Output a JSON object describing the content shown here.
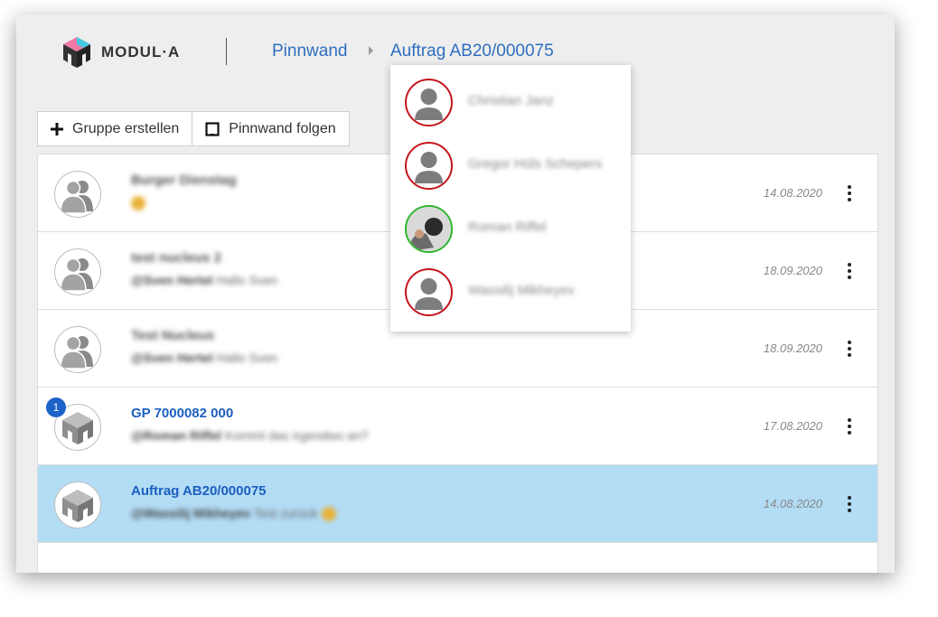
{
  "header": {
    "logo_text": "MODUL·A",
    "breadcrumb": [
      "Pinnwand",
      "Auftrag AB20/000075"
    ]
  },
  "toolbar": {
    "create_group_label": "Gruppe erstellen",
    "follow_label": "Pinnwand folgen"
  },
  "rows": [
    {
      "title": "Burger Dienstag",
      "author": "",
      "message": "",
      "date": "14.08.2020",
      "avatar": "group",
      "badge": ""
    },
    {
      "title": "test nucleus 2",
      "author": "@Sven Hertel",
      "message": "Hallo Sven",
      "date": "18.09.2020",
      "avatar": "group",
      "badge": ""
    },
    {
      "title": "Test Nucleus",
      "author": "@Sven Hertel",
      "message": "Hallo Sven",
      "date": "18.09.2020",
      "avatar": "group",
      "badge": ""
    },
    {
      "title": "GP 7000082 000",
      "author": "@Roman Riffel",
      "message": "Kommt das irgendwo an?",
      "date": "17.08.2020",
      "avatar": "logo",
      "badge": "1"
    },
    {
      "title": "Auftrag AB20/000075",
      "author": "@Wassilij Mikheyev",
      "message": "Test zurück",
      "date": "14.08.2020",
      "avatar": "logo",
      "badge": ""
    }
  ],
  "members": [
    {
      "name": "Christian Janz",
      "status": "offline"
    },
    {
      "name": "Gregor Hüls Schepers",
      "status": "offline"
    },
    {
      "name": "Roman Riffel",
      "status": "online"
    },
    {
      "name": "Wassilij Mikheyev",
      "status": "offline"
    }
  ],
  "icons": {
    "create_group": "plus-icon",
    "follow": "bookmark-icon",
    "row_menu": "more-vertical-icon",
    "crumb_separator": "chevron-right-icon"
  },
  "colors": {
    "accent": "#2f6fbf",
    "selected_row": "#b3dcf5",
    "badge": "#1c63c8",
    "offline_ring": "#c5151d",
    "online_ring": "#2bb52b"
  }
}
